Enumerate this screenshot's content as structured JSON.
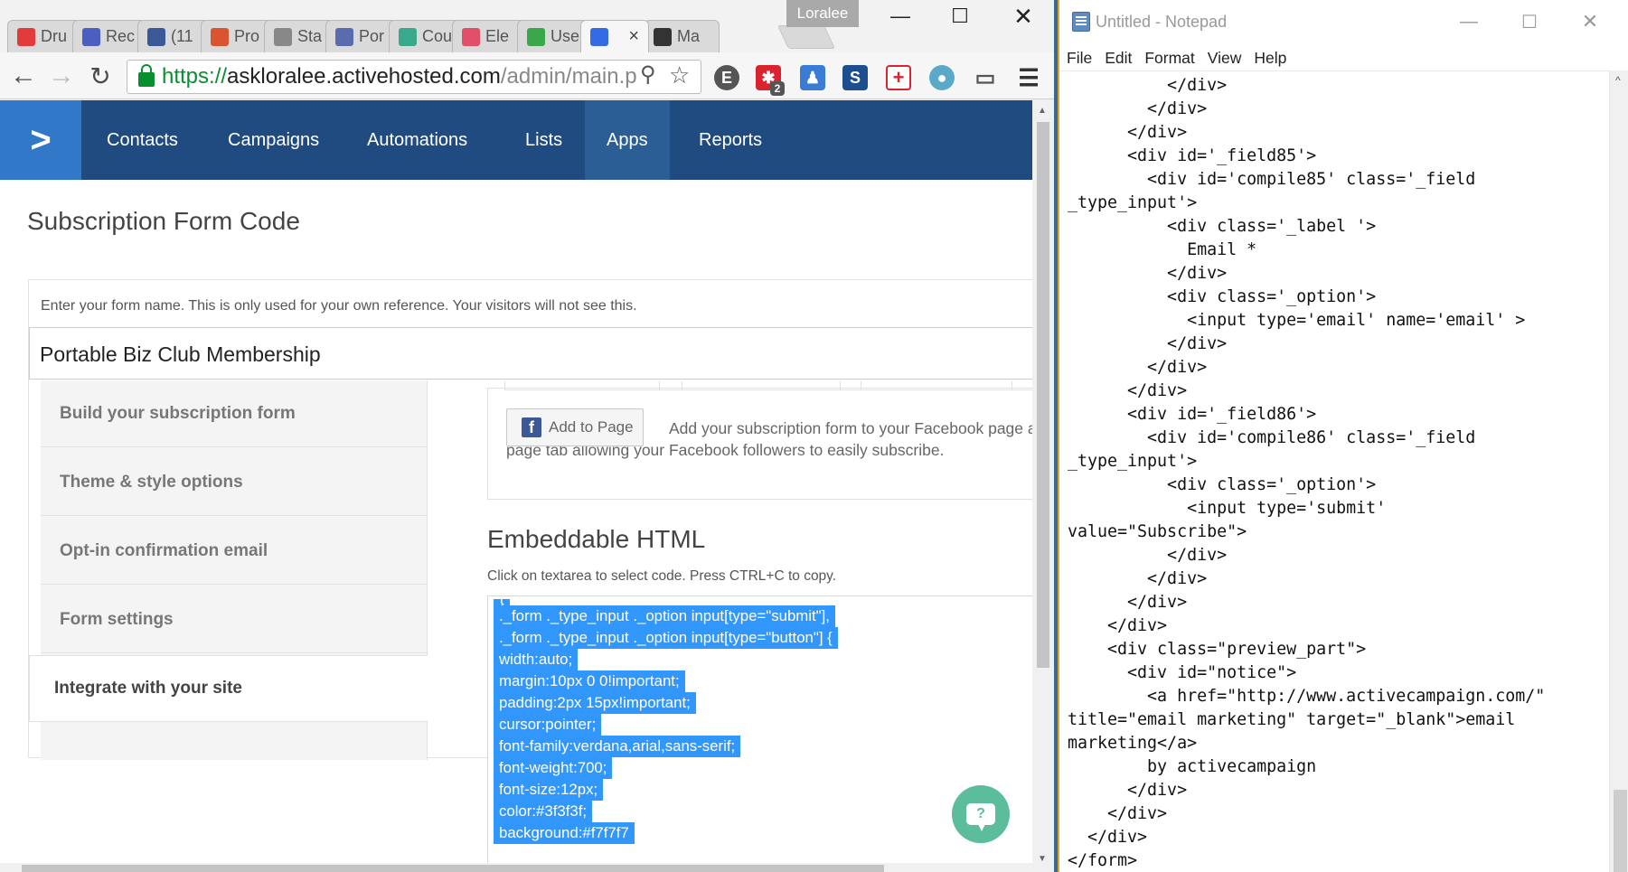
{
  "browser": {
    "profile_name": "Loralee",
    "tabs": [
      {
        "title": "Dru",
        "icon": "plus-icon",
        "color": "#e33b3b"
      },
      {
        "title": "Rec",
        "icon": "meditation-icon",
        "color": "#4a5fc1"
      },
      {
        "title": "(11",
        "icon": "facebook-icon",
        "color": "#3b5998"
      },
      {
        "title": "Pro",
        "icon": "producthunt-icon",
        "color": "#da552f"
      },
      {
        "title": "Sta",
        "icon": "document-icon",
        "color": "#888888"
      },
      {
        "title": "Por",
        "icon": "bar-chart-icon",
        "color": "#5b6bb0"
      },
      {
        "title": "Cou",
        "icon": "t-icon",
        "color": "#3aa88a"
      },
      {
        "title": "Ele",
        "icon": "asterisk-icon",
        "color": "#e24f6a"
      },
      {
        "title": "Use",
        "icon": "swirl-icon",
        "color": "#3aa84a"
      },
      {
        "title": "",
        "icon": "activecampaign-icon",
        "color": "#356ae6",
        "active": true
      },
      {
        "title": "Ma",
        "icon": "x-logo-icon",
        "color": "#333333"
      }
    ],
    "tab_close_symbol": "×",
    "url": {
      "scheme": "https://",
      "host": "askloralee.activehosted.com",
      "path": "/admin/main.p"
    },
    "extension_badge": "2"
  },
  "app": {
    "logo_symbol": ">",
    "nav": [
      {
        "label": "Contacts",
        "active": false
      },
      {
        "label": "Campaigns",
        "active": false
      },
      {
        "label": "Automations",
        "active": false
      },
      {
        "label": "Lists",
        "active": false
      },
      {
        "label": "Apps",
        "active": true
      },
      {
        "label": "Reports",
        "active": false
      }
    ],
    "page_title": "Subscription Form Code",
    "form_hint": "Enter your form name. This is only used for your own reference. Your visitors will not see this.",
    "form_name": "Portable Biz Club Membership",
    "steps": [
      {
        "label": "Build your subscription form",
        "active": false
      },
      {
        "label": "Theme & style options",
        "active": false
      },
      {
        "label": "Opt-in confirmation email",
        "active": false
      },
      {
        "label": "Form settings",
        "active": false
      },
      {
        "label": "Integrate with your site",
        "active": true
      }
    ],
    "facebook": {
      "icon_letter": "f",
      "button_label": "Add to Page",
      "description": "Add your subscription form to your Facebook page as page tab allowing your Facebook followers to easily subscribe."
    },
    "embed": {
      "title": "Embeddable HTML",
      "hint": "Click on textarea to select code. Press CTRL+C to copy.",
      "code_lines": [
        "}",
        "._form ._type_input ._option input[type=\"submit\"],",
        "._form ._type_input ._option input[type=\"button\"] {",
        "width:auto;",
        "margin:10px 0 0!important;",
        "padding:2px 15px!important;",
        "cursor:pointer;",
        "font-family:verdana,arial,sans-serif;",
        "font-weight:700;",
        "font-size:12px;",
        "color:#3f3f3f;",
        "background:#f7f7f7"
      ]
    },
    "chat_symbol": "?",
    "colors": {
      "nav_bg": "#204b80",
      "logo_bg": "#3278c8",
      "selection": "#3297fd",
      "chat": "#5bbd9c"
    }
  },
  "notepad": {
    "title": "Untitled - Notepad",
    "menu": [
      "File",
      "Edit",
      "Format",
      "View",
      "Help"
    ],
    "lines": [
      "          </div>",
      "        </div>",
      "      </div>",
      "      <div id='_field85'>",
      "        <div id='compile85' class='_field",
      "_type_input'>",
      "          <div class='_label '>",
      "            Email *",
      "          </div>",
      "          <div class='_option'>",
      "            <input type='email' name='email' >",
      "          </div>",
      "        </div>",
      "      </div>",
      "      <div id='_field86'>",
      "        <div id='compile86' class='_field",
      "_type_input'>",
      "          <div class='_option'>",
      "            <input type='submit'",
      "value=\"Subscribe\">",
      "          </div>",
      "        </div>",
      "      </div>",
      "    </div>",
      "    <div class=\"preview_part\">",
      "      <div id=\"notice\">",
      "        <a href=\"http://www.activecampaign.com/\"",
      "title=\"email marketing\" target=\"_blank\">email",
      "marketing</a>",
      "        by activecampaign",
      "      </div>",
      "    </div>",
      "  </div>",
      "</form>"
    ]
  }
}
